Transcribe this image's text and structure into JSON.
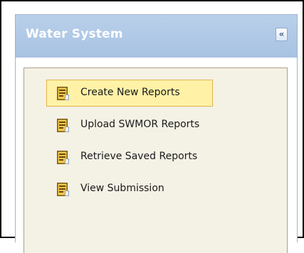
{
  "panel": {
    "title": "Water System",
    "collapse_symbol": "«",
    "header_color": "#b0c8e6",
    "content_bg": "#f4f1e5",
    "highlight_bg": "#fff2a6"
  },
  "menu": {
    "items": [
      {
        "label": "Create New Reports",
        "icon": "report-icon",
        "active": true
      },
      {
        "label": "Upload SWMOR Reports",
        "icon": "report-icon",
        "active": false
      },
      {
        "label": "Retrieve Saved Reports",
        "icon": "report-icon",
        "active": false
      },
      {
        "label": "View Submission",
        "icon": "report-icon",
        "active": false
      }
    ]
  }
}
